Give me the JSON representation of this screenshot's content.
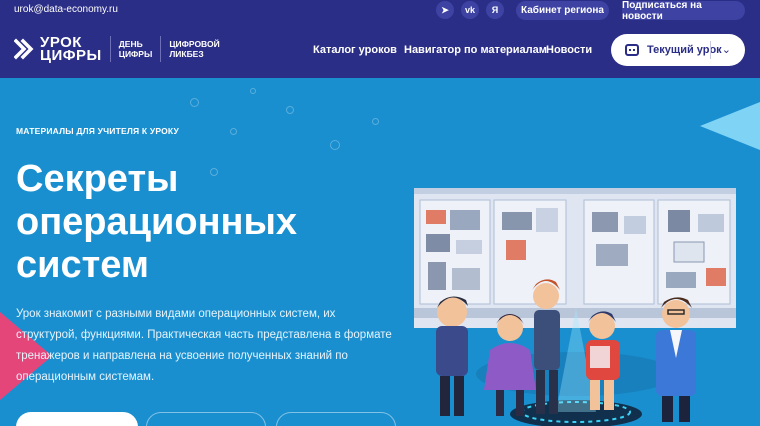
{
  "topbar": {
    "email": "urok@data-economy.ru",
    "social": [
      {
        "icon": "telegram-icon",
        "glyph": "➤"
      },
      {
        "icon": "vk-icon",
        "glyph": "vk"
      },
      {
        "icon": "yandex-icon",
        "glyph": "Я"
      }
    ],
    "region_cabinet": "Кабинет региона",
    "subscribe": "Подписаться на новости"
  },
  "logo": {
    "line1": "УРОК",
    "line2": "ЦИФРЫ",
    "sub1_line1": "ДЕНЬ",
    "sub1_line2": "ЦИФРЫ",
    "sub2_line1": "ЦИФРОВОЙ",
    "sub2_line2": "ЛИКБЕЗ"
  },
  "nav": {
    "catalog": "Каталог уроков",
    "navigator": "Навигатор по материалам",
    "news": "Новости",
    "current_lesson": "Текущий урок"
  },
  "hero": {
    "eyebrow": "МАТЕРИАЛЫ ДЛЯ УЧИТЕЛЯ К УРОКУ",
    "title_line1": "Секреты",
    "title_line2": "операционных",
    "title_line3": "систем",
    "description": "Урок знакомит с разными видами операционных систем, их структурой, функциями. Практическая часть представлена в формате тренажеров и направлена на усвоение полученных знаний по операционным системам."
  },
  "colors": {
    "nav_bg": "#2b2e86",
    "hero_bg": "#1a8fcf",
    "accent_pink": "#e5467a"
  }
}
